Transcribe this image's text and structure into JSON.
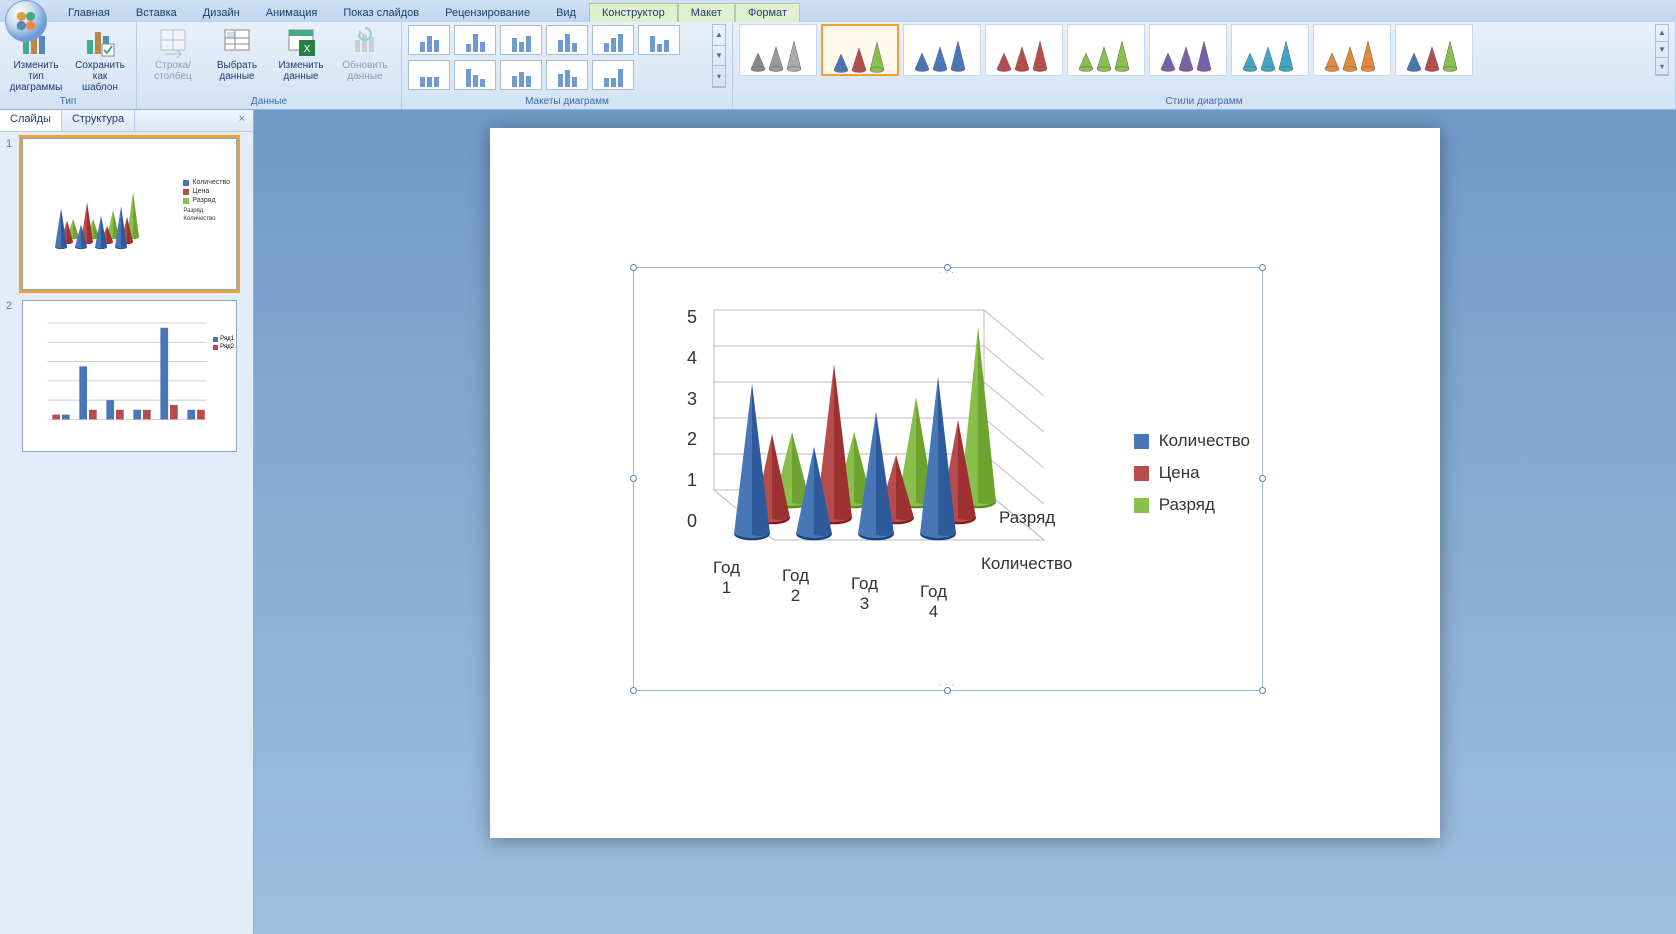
{
  "ribbon_tabs": {
    "home": "Главная",
    "insert": "Вставка",
    "design": "Дизайн",
    "animation": "Анимация",
    "slideshow": "Показ слайдов",
    "review": "Рецензирование",
    "view": "Вид",
    "ctx_design": "Конструктор",
    "ctx_layout": "Макет",
    "ctx_format": "Формат"
  },
  "ribbon_groups": {
    "type": {
      "label": "Тип",
      "change_type": "Изменить тип диаграммы",
      "save_template": "Сохранить как шаблон"
    },
    "data": {
      "label": "Данные",
      "switch_rc": "Строка/столбец",
      "select_data": "Выбрать данные",
      "edit_data": "Изменить данные",
      "refresh": "Обновить данные"
    },
    "layouts": {
      "label": "Макеты диаграмм"
    },
    "styles": {
      "label": "Стили диаграмм"
    }
  },
  "side_panel": {
    "tab_slides": "Слайды",
    "tab_outline": "Структура",
    "close": "×",
    "slide1_num": "1",
    "slide2_num": "2"
  },
  "chart_data": {
    "type": "bar",
    "subtype": "3d-cone",
    "categories": [
      "Год 1",
      "Год 2",
      "Год 3",
      "Год 4"
    ],
    "series": [
      {
        "name": "Количество",
        "color": "#4876b6",
        "values": [
          4.3,
          2.5,
          3.5,
          4.5
        ]
      },
      {
        "name": "Цена",
        "color": "#b84c4c",
        "values": [
          2.4,
          4.4,
          1.8,
          2.8
        ]
      },
      {
        "name": "Разряд",
        "color": "#8bbf4d",
        "values": [
          2.0,
          2.0,
          3.0,
          5.0
        ]
      }
    ],
    "depth_labels": [
      "Разряд",
      "Количество"
    ],
    "y_ticks": [
      "5",
      "4",
      "3",
      "2",
      "1",
      "0"
    ],
    "ylim": [
      0,
      5
    ]
  },
  "thumb1_legend": {
    "a": "Количество",
    "b": "Цена",
    "c": "Разряд",
    "d": "Разряд",
    "e": "Количество"
  },
  "thumb2_legend": {
    "a": "Ряд1",
    "b": "Ряд2"
  }
}
